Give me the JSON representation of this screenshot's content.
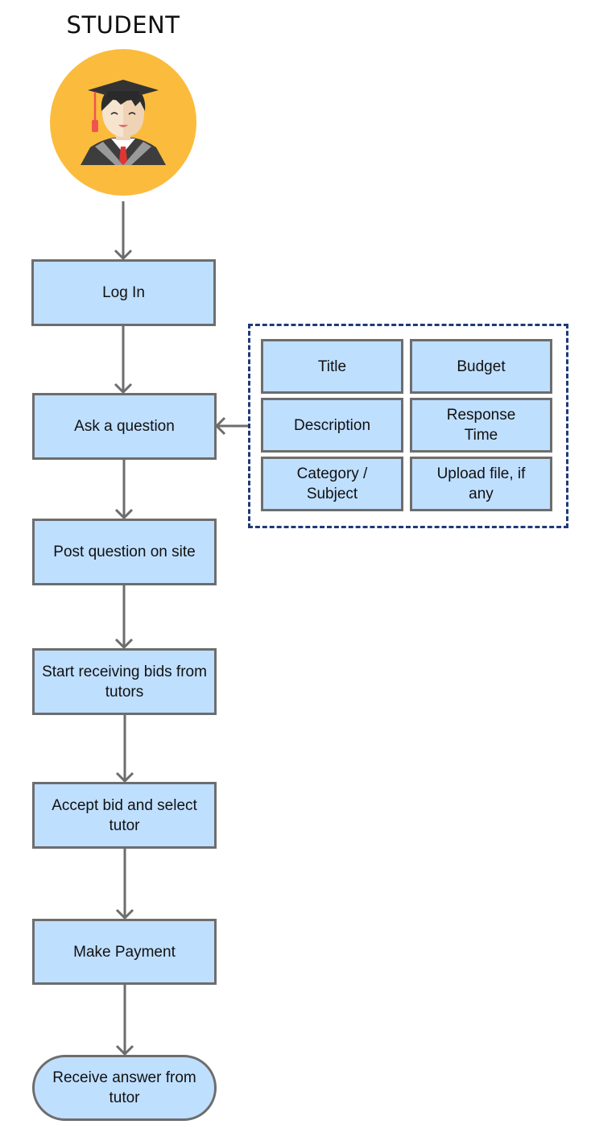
{
  "diagram": {
    "actor": {
      "label": "STUDENT",
      "icon": "graduate-student-icon",
      "circle_color": "#fbbb3c"
    },
    "steps": [
      {
        "id": "login",
        "label": "Log In",
        "shape": "rect"
      },
      {
        "id": "ask",
        "label": "Ask a question",
        "shape": "rect"
      },
      {
        "id": "post",
        "label": "Post question on site",
        "shape": "rect"
      },
      {
        "id": "bids",
        "label": "Start receiving bids from tutors",
        "shape": "rect"
      },
      {
        "id": "accept",
        "label": "Accept bid and select tutor",
        "shape": "rect"
      },
      {
        "id": "payment",
        "label": "Make Payment",
        "shape": "rect"
      },
      {
        "id": "receive",
        "label": "Receive answer from tutor",
        "shape": "terminal"
      }
    ],
    "question_fields": {
      "target_step": "ask",
      "fields": [
        {
          "label": "Title"
        },
        {
          "label": "Budget"
        },
        {
          "label": "Description"
        },
        {
          "label": "Response Time"
        },
        {
          "label": "Category / Subject"
        },
        {
          "label": "Upload file, if any"
        }
      ]
    },
    "colors": {
      "node_fill": "#bfdfff",
      "node_border": "#6d6d6d",
      "connector": "#6d6d6d",
      "group_border": "#1f3a7a"
    }
  }
}
